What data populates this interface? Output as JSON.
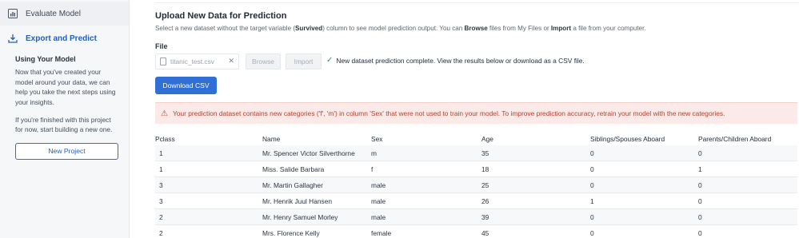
{
  "sidebar": {
    "items": [
      {
        "label": "Evaluate Model",
        "icon": "chart-icon"
      },
      {
        "label": "Export and Predict",
        "icon": "export-icon"
      }
    ],
    "info_title": "Using Your Model",
    "info_p1": "Now that you've created your model around your data, we can help you take the next steps using your insights.",
    "info_p2": "If you're finished with this project for now, start building a new one.",
    "new_project": "New Project"
  },
  "main": {
    "title": "Upload New Data for Prediction",
    "subtitle_parts": [
      "Select a new dataset without the target variable (",
      "Survived",
      ") column to see model prediction output. You can ",
      "Browse",
      " files from My Files or ",
      "Import",
      " a file from your computer."
    ],
    "file_label": "File",
    "file_value": "titanic_test.csv",
    "browse": "Browse",
    "import": "Import",
    "success": "New dataset prediction complete. View the results below or download as a CSV file.",
    "download": "Download CSV",
    "warning": "Your prediction dataset contains new categories ('f', 'm') in column 'Sex' that were not used to train your model. To improve prediction accuracy, retrain your model with the new categories."
  },
  "table": {
    "headers": [
      "Pclass",
      "Name",
      "Sex",
      "Age",
      "Siblings/Spouses Aboard",
      "Parents/Children Aboard"
    ],
    "rows": [
      [
        "1",
        "Mr. Spencer Victor Silverthorne",
        "m",
        "35",
        "0",
        "0"
      ],
      [
        "1",
        "Miss. Salide Barbara",
        "f",
        "18",
        "0",
        "1"
      ],
      [
        "3",
        "Mr. Martin Gallagher",
        "male",
        "25",
        "0",
        "0"
      ],
      [
        "3",
        "Mr. Henrik Juul Hansen",
        "male",
        "26",
        "1",
        "0"
      ],
      [
        "2",
        "Mr. Henry Samuel Morley",
        "male",
        "39",
        "0",
        "0"
      ],
      [
        "2",
        "Mrs. Florence Kelly",
        "female",
        "45",
        "0",
        "0"
      ]
    ]
  },
  "colors": {
    "accent": "#2f6fd6",
    "warning_bg": "#fbeae7",
    "warning_text": "#b5402f",
    "success": "#2e8b57"
  }
}
